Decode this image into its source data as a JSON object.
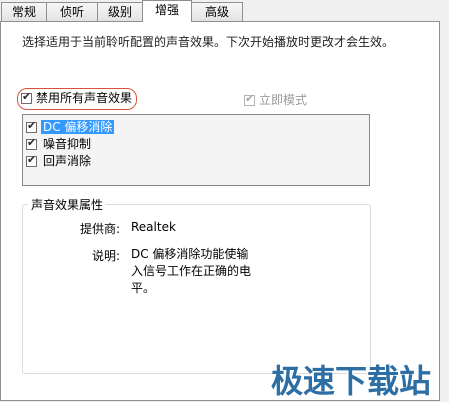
{
  "tabs": [
    {
      "label": "常规"
    },
    {
      "label": "侦听"
    },
    {
      "label": "级别"
    },
    {
      "label": "增强"
    },
    {
      "label": "高级"
    }
  ],
  "active_tab": "增强",
  "description": "选择适用于当前聆听配置的声音效果。下次开始播放时更改才会生效。",
  "disable_all": {
    "label": "禁用所有声音效果",
    "checked": true
  },
  "immediate_mode": {
    "label": "立即模式",
    "checked": true,
    "enabled": false
  },
  "effects": [
    {
      "label": "DC 偏移消除",
      "checked": true,
      "selected": true
    },
    {
      "label": "噪音抑制",
      "checked": true,
      "selected": false
    },
    {
      "label": "回声消除",
      "checked": true,
      "selected": false
    }
  ],
  "properties": {
    "title": "声音效果属性",
    "provider_label": "提供商:",
    "provider_value": "Realtek",
    "description_label": "说明:",
    "description_value": "DC 偏移消除功能使输入信号工作在正确的电平。"
  },
  "watermark": "极速下载站",
  "colors": {
    "selection": "#3399ff",
    "highlight_ring": "#d9533b",
    "watermark": "#2d6ea5"
  }
}
